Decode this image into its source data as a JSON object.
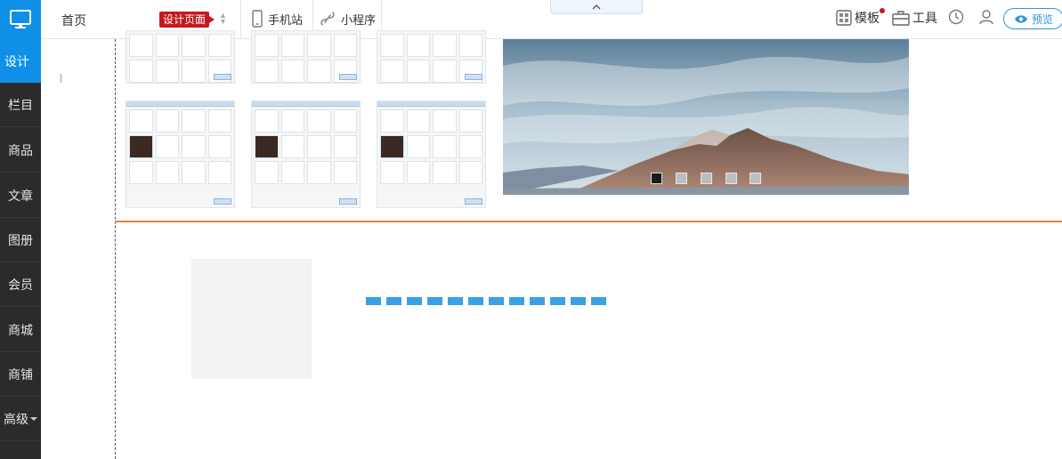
{
  "sidebar": {
    "design_label": "设计",
    "items": [
      {
        "label": "栏目"
      },
      {
        "label": "商品"
      },
      {
        "label": "文章"
      },
      {
        "label": "图册"
      },
      {
        "label": "会员"
      },
      {
        "label": "商城"
      },
      {
        "label": "商铺"
      },
      {
        "label": "高级"
      }
    ]
  },
  "topbar": {
    "home_label": "首页",
    "current_page": "设计页面",
    "mobile_label": "手机站",
    "miniprogram_label": "小程序",
    "template_label": "模板",
    "tools_label": "工具",
    "preview_label": "预览"
  },
  "colors": {
    "brand_blue": "#0f8fe8",
    "page_badge_red": "#c6191f",
    "divider_orange": "#e3833b",
    "loading_blue": "#3aa1e6",
    "sidebar_dark": "#2b2b2b"
  },
  "icons": [
    "monitor-icon",
    "plus-icon",
    "mobile-icon",
    "link-icon",
    "chevron-up-icon",
    "template-icon",
    "toolbox-icon",
    "clock-icon",
    "user-icon",
    "eye-icon",
    "caret-down-icon"
  ],
  "carousel": {
    "slide_count": 5,
    "active_index": 0
  }
}
